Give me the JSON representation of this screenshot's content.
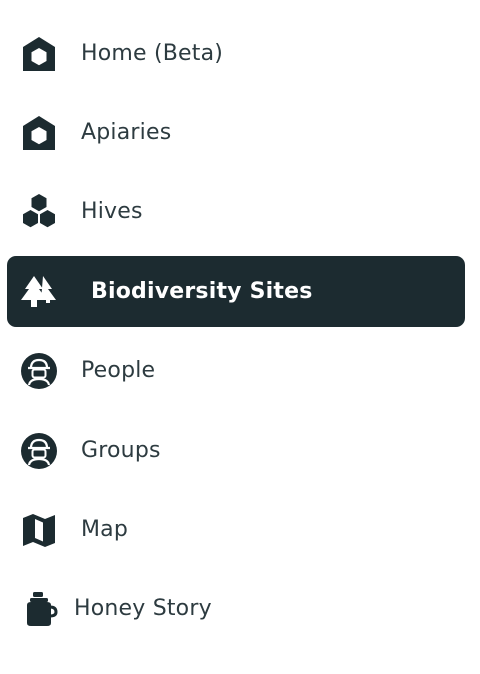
{
  "colors": {
    "icon": "#1c2b30",
    "text": "#2d3b40",
    "active_bg": "#1c2b30",
    "active_text": "#ffffff"
  },
  "nav": {
    "items": [
      {
        "label": "Home (Beta)",
        "icon": "home-icon",
        "active": false
      },
      {
        "label": "Apiaries",
        "icon": "apiary-icon",
        "active": false
      },
      {
        "label": "Hives",
        "icon": "hives-icon",
        "active": false
      },
      {
        "label": "Biodiversity Sites",
        "icon": "trees-icon",
        "active": true
      },
      {
        "label": "People",
        "icon": "beekeeper-icon",
        "active": false
      },
      {
        "label": "Groups",
        "icon": "beekeeper-group-icon",
        "active": false
      },
      {
        "label": "Map",
        "icon": "map-icon",
        "active": false
      },
      {
        "label": "Honey Story",
        "icon": "honey-jar-icon",
        "active": false
      }
    ]
  }
}
